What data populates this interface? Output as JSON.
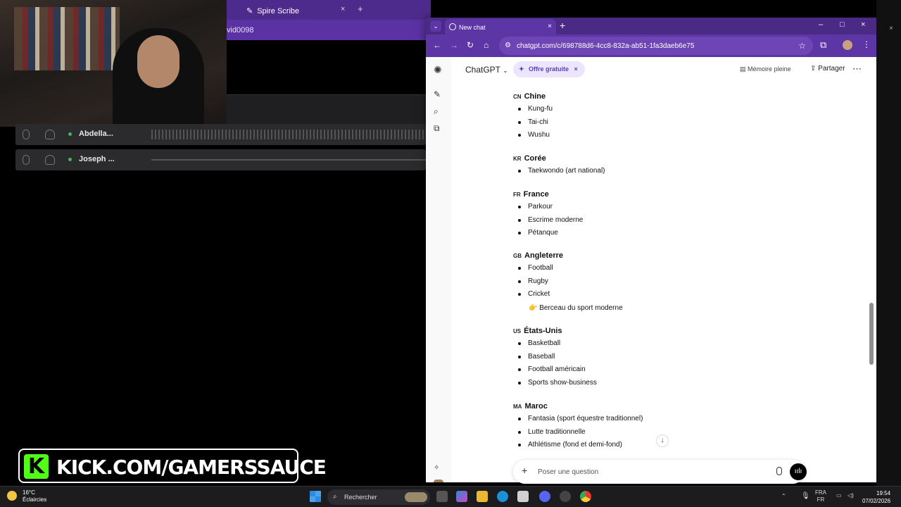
{
  "background_window": {
    "tab_title": "Spire Scribe",
    "address_fragment": "vid0098",
    "recorder_rows": [
      {
        "name": "Abdella...",
        "active": true
      },
      {
        "name": "Joseph ...",
        "active": false
      }
    ]
  },
  "browser": {
    "tab_title": "New chat",
    "url": "chatgpt.com/c/698788d6-4cc8-832a-ab51-1fa3daeb6e75",
    "new_tab": "+",
    "close": "×",
    "minimize": "–",
    "maximize": "□"
  },
  "chatgpt": {
    "model_label": "ChatGPT",
    "offer_label": "Offre gratuite",
    "memory_label": "Mémoire pleine",
    "share_label": "Partager",
    "composer_placeholder": "Poser une question",
    "sections": [
      {
        "flag": "CN",
        "title": "Chine",
        "items": [
          "Kung-fu",
          "Tai-chi",
          "Wushu"
        ]
      },
      {
        "flag": "KR",
        "title": "Corée",
        "items": [
          "Taekwondo (art national)"
        ]
      },
      {
        "flag": "FR",
        "title": "France",
        "items": [
          "Parkour",
          "Escrime moderne",
          "Pétanque"
        ]
      },
      {
        "flag": "GB",
        "title": "Angleterre",
        "items": [
          "Football",
          "Rugby",
          "Cricket"
        ],
        "note": "👉 Berceau du sport moderne"
      },
      {
        "flag": "US",
        "title": "États-Unis",
        "items": [
          "Basketball",
          "Baseball",
          "Football américain",
          "Sports show-business"
        ]
      },
      {
        "flag": "MA",
        "title": "Maroc",
        "items": [
          "Fantasia (sport équestre traditionnel)",
          "Lutte traditionnelle",
          "Athlétisme (fond et demi-fond)"
        ]
      }
    ]
  },
  "overlay": {
    "kick_text": "KICK.COM/GAMERSSAUCE",
    "kick_logo": "K"
  },
  "taskbar": {
    "weather_temp": "16°C",
    "weather_desc": "Éclaircies",
    "search_label": "Rechercher",
    "lang_top": "FRA",
    "lang_bottom": "FR",
    "time": "19:54",
    "date": "07/02/2026",
    "colors": {
      "kick_green": "#53fc18",
      "chrome_purple": "#5d36a6",
      "offer_bg": "#ebe6fb"
    }
  }
}
